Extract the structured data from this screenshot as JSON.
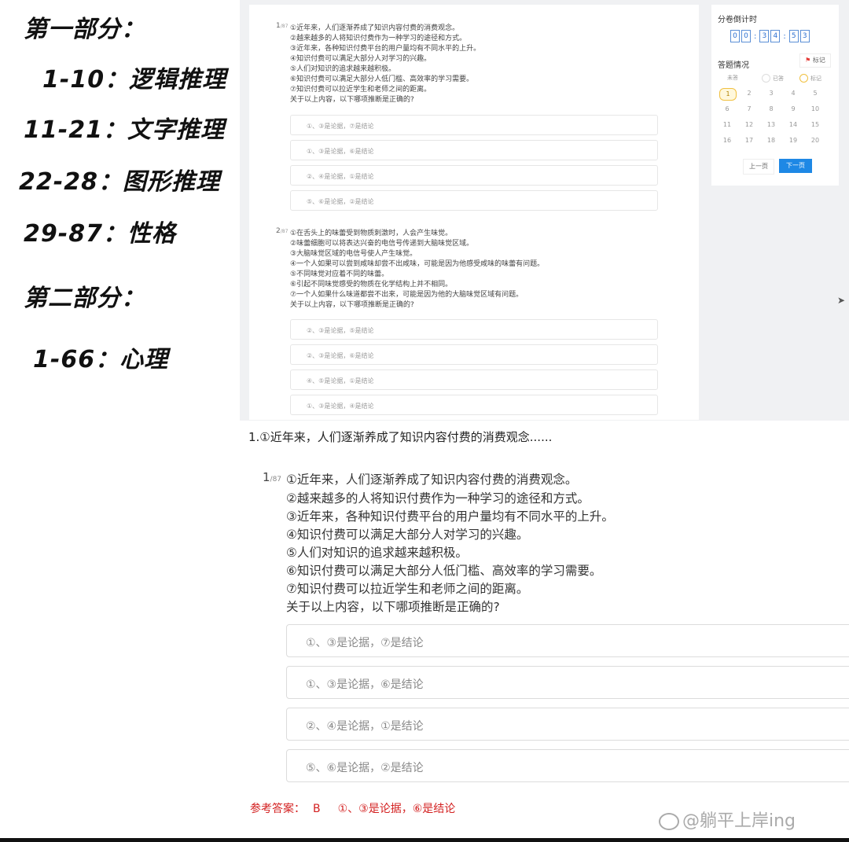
{
  "outline": {
    "part1": "第一部分：",
    "items1": [
      "1-10：逻辑推理",
      "11-21：文字推理",
      "22-28：图形推理",
      "29-87：性格"
    ],
    "part2": "第二部分：",
    "items2": [
      "1-66：心理"
    ]
  },
  "screen": {
    "q1": {
      "num": "1",
      "total": "/87",
      "lines": [
        "①近年来，人们逐渐养成了知识内容付费的消费观念。",
        "②越来越多的人将知识付费作为一种学习的途径和方式。",
        "③近年来，各种知识付费平台的用户量均有不同水平的上升。",
        "④知识付费可以满足大部分人对学习的兴趣。",
        "⑤人们对知识的追求越来越积极。",
        "⑥知识付费可以满足大部分人低门槛、高效率的学习需要。",
        "⑦知识付费可以拉近学生和老师之间的距离。",
        "关于以上内容，以下哪项推断是正确的?"
      ],
      "options": [
        "①、③是论据，⑦是结论",
        "①、③是论据，⑥是结论",
        "②、④是论据，①是结论",
        "⑤、⑥是论据，②是结论"
      ]
    },
    "q2": {
      "num": "2",
      "total": "/87",
      "lines": [
        "①在舌头上的味蕾受到物质刺激时，人会产生味觉。",
        "②味蕾细胞可以将表达兴奋的电信号传递到大脑味觉区域。",
        "③大脑味觉区域的电信号使人产生味觉。",
        "④一个人如果可以尝到咸味却尝不出咸味，可能是因为他感受咸味的味蕾有问题。",
        "⑤不同味觉对应着不同的味蕾。",
        "⑥引起不同味觉感受的物质在化学结构上并不相同。",
        "⑦一个人如果什么味道都尝不出来，可能是因为他的大脑味觉区域有问题。",
        "关于以上内容，以下哪项推断是正确的?"
      ],
      "options": [
        "②、③是论据，⑤是结论",
        "②、③是论据，⑥是结论",
        "④、⑤是论据，①是结论",
        "①、③是论据，④是结论"
      ]
    },
    "sidebar": {
      "countdown_label": "分卷倒计时",
      "timer_digits": [
        "0",
        "0",
        "3",
        "4",
        "5",
        "3"
      ],
      "answer_label": "答题情况",
      "mark_label": "标记",
      "legend": [
        "未答",
        "已答",
        "标记"
      ],
      "grid": [
        "1",
        "2",
        "3",
        "4",
        "5",
        "6",
        "7",
        "8",
        "9",
        "10",
        "11",
        "12",
        "13",
        "14",
        "15",
        "16",
        "17",
        "18",
        "19",
        "20"
      ],
      "current": "1",
      "prev_label": "上一页",
      "next_label": "下一页"
    }
  },
  "zoom": {
    "title": "1.①近年来，人们逐渐养成了知识内容付费的消费观念......",
    "num": "1",
    "total": "/87",
    "lines": [
      "①近年来，人们逐渐养成了知识内容付费的消费观念。",
      "②越来越多的人将知识付费作为一种学习的途径和方式。",
      "③近年来，各种知识付费平台的用户量均有不同水平的上升。",
      "④知识付费可以满足大部分人对学习的兴趣。",
      "⑤人们对知识的追求越来越积极。",
      "⑥知识付费可以满足大部分人低门槛、高效率的学习需要。",
      "⑦知识付费可以拉近学生和老师之间的距离。",
      "关于以上内容，以下哪项推断是正确的?"
    ],
    "options": [
      "①、③是论据，⑦是结论",
      "①、③是论据，⑥是结论",
      "②、④是论据，①是结论",
      "⑤、⑥是论据，②是结论"
    ],
    "answer_label": "参考答案：",
    "answer_letter": "B",
    "answer_expl": "①、③是论据，⑥是结论"
  },
  "watermark": "@躺平上岸ing",
  "colors": {
    "accent": "#1e88e5",
    "answer": "#d32020",
    "timer": "#2c6fd1"
  }
}
